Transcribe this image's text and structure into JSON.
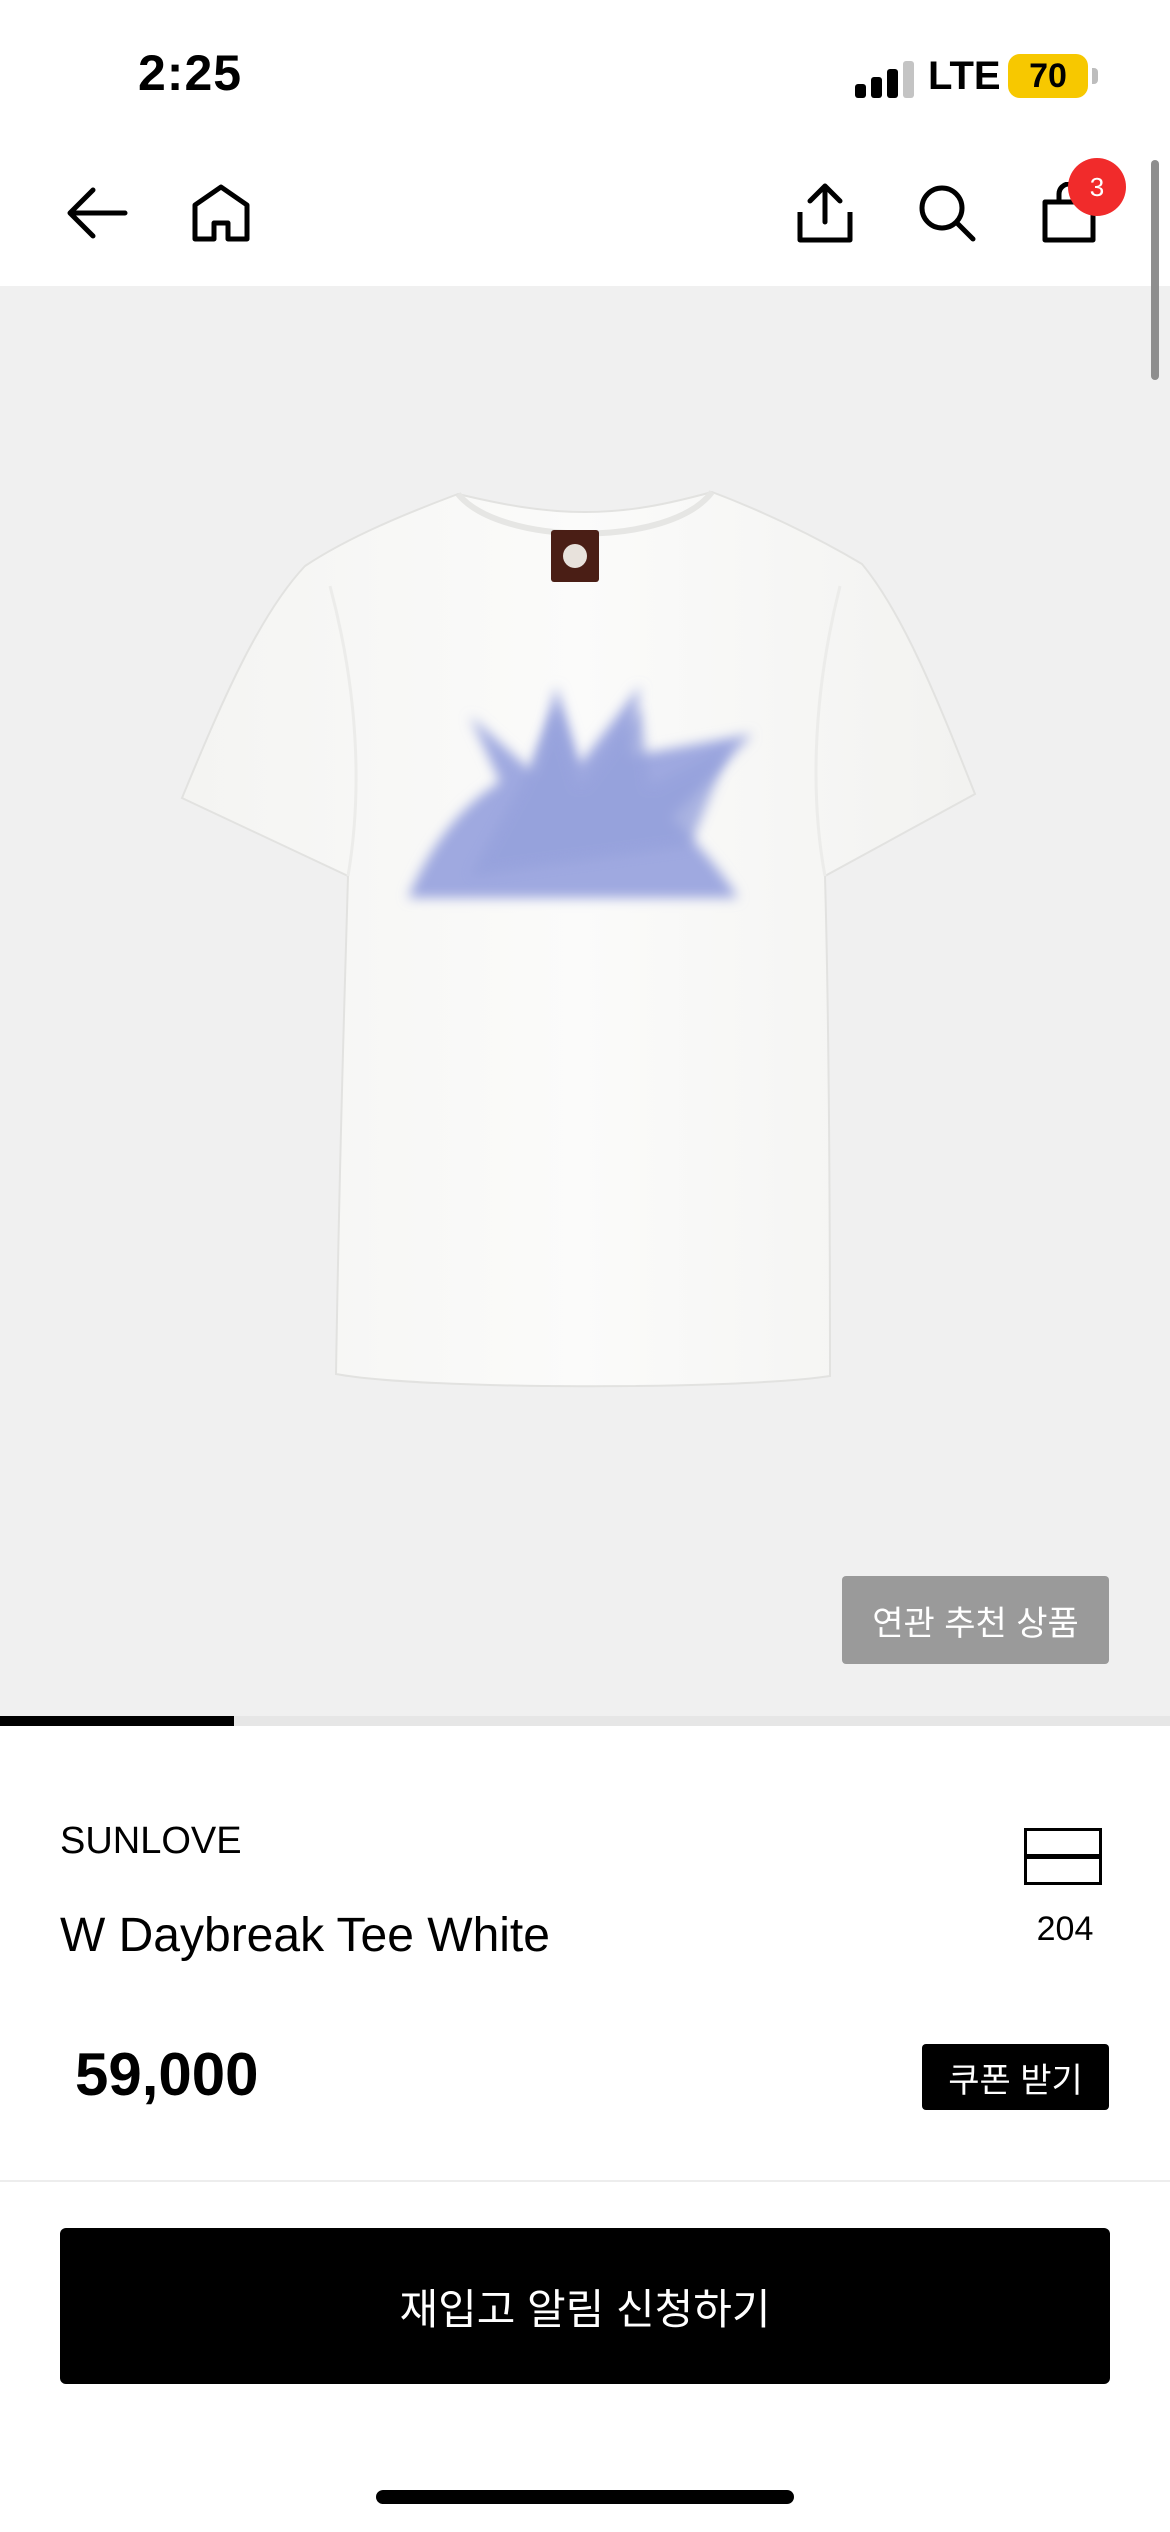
{
  "status_bar": {
    "time": "2:25",
    "network": "LTE",
    "battery": "70",
    "signal_bars_active": 3,
    "battery_color": "#f7c800"
  },
  "nav": {
    "back_icon": "arrow-left-icon",
    "home_icon": "home-icon",
    "share_icon": "share-icon",
    "search_icon": "search-icon",
    "cart_icon": "shopping-bag-icon",
    "cart_count": "3",
    "badge_color": "#f12b2b"
  },
  "gallery": {
    "related_button": "연관 추천 상품",
    "progress_fraction": 0.2,
    "background": "#f0f0f0"
  },
  "product": {
    "brand": "SUNLOVE",
    "name": "W Daybreak Tee White",
    "list_count": "204",
    "price": "59,000",
    "coupon_button": "쿠폰 받기"
  },
  "cta": {
    "label": "재입고 알림 신청하기"
  }
}
